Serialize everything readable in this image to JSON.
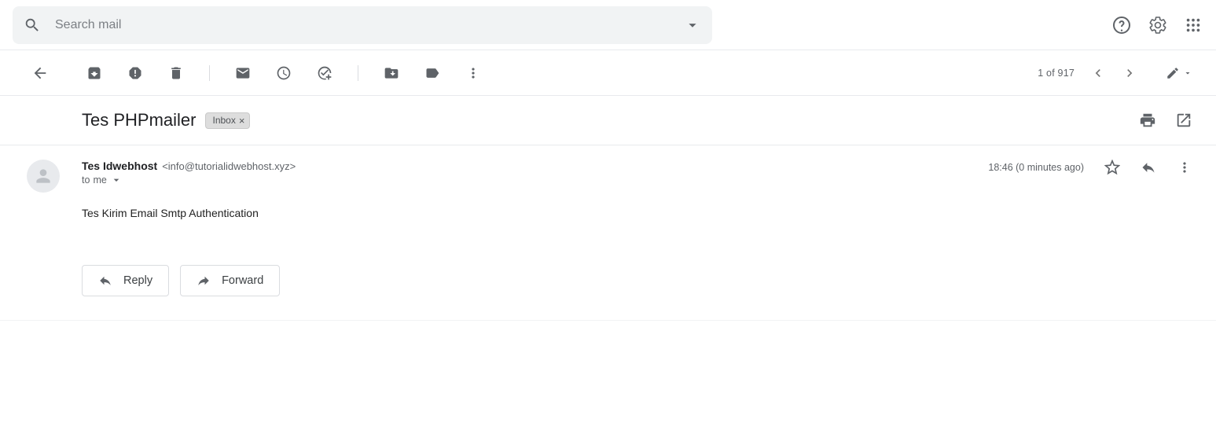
{
  "search": {
    "placeholder": "Search mail"
  },
  "toolbar": {
    "counter": "1 of 917"
  },
  "subject": {
    "text": "Tes PHPmailer",
    "chip_label": "Inbox"
  },
  "message": {
    "sender_name": "Tes Idwebhost",
    "sender_addr": "<info@tutorialidwebhost.xyz>",
    "to_prefix": "to",
    "to_target": "me",
    "timestamp": "18:46 (0 minutes ago)",
    "body": "Tes Kirim Email Smtp Authentication"
  },
  "actions": {
    "reply": "Reply",
    "forward": "Forward"
  }
}
